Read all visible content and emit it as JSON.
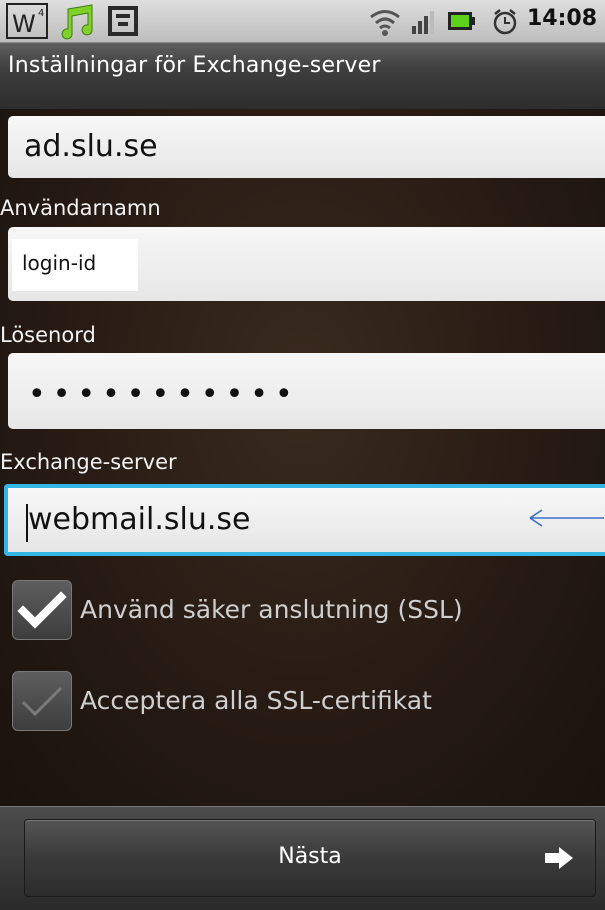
{
  "statusbar": {
    "time": "14:08",
    "icons": [
      "widget-w-icon",
      "music-note-icon",
      "sync-app-icon",
      "wifi-icon",
      "signal-icon",
      "battery-icon",
      "alarm-icon"
    ]
  },
  "title": "Inställningar för Exchange-server",
  "domain": {
    "value": "ad.slu.se"
  },
  "username": {
    "label": "Användarnamn",
    "value": "login-id"
  },
  "password": {
    "label": "Lösenord",
    "value": "•••••••••••"
  },
  "server": {
    "label": "Exchange-server",
    "value": "webmail.slu.se"
  },
  "options": [
    {
      "label": "Använd säker anslutning (SSL)",
      "checked": true
    },
    {
      "label": "Acceptera alla SSL-certifikat",
      "checked": false
    }
  ],
  "next_button": {
    "label": "Nästa"
  },
  "colors": {
    "focus": "#33b5e5",
    "annotation_arrow": "#3a6fc8",
    "music_icon": "#7fd12a"
  }
}
